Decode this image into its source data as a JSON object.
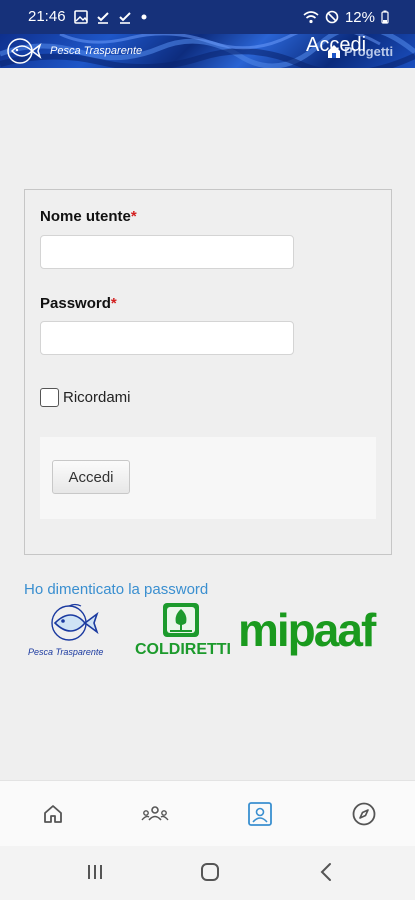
{
  "status_bar": {
    "time": "21:46",
    "battery": "12%"
  },
  "header": {
    "brand": "Pesca Trasparente",
    "title": "Accedi",
    "subtitle": "Progetti"
  },
  "form": {
    "username_label": "Nome utente",
    "password_label": "Password",
    "required_mark": "*",
    "username_value": "",
    "password_value": "",
    "remember_label": "Ricordami",
    "remember_checked": false,
    "submit_label": "Accedi"
  },
  "links": {
    "forgot_password": "Ho dimenticato la password"
  },
  "logos": {
    "pesca": "Pesca Trasparente",
    "coldiretti": "COLDIRETTI",
    "mipaaf": "mipaaf"
  },
  "colors": {
    "status_bar": "#16317a",
    "link": "#3a8fd0",
    "required": "#d32020",
    "nav_active": "#3a8fd0",
    "logo_green": "#1a9a1e"
  },
  "bottom_nav": {
    "items": [
      "home-icon",
      "community-icon",
      "profile-card-icon",
      "compass-icon"
    ],
    "active": "profile-card-icon"
  },
  "system_nav": [
    "recents-icon",
    "home-circle-icon",
    "back-icon"
  ]
}
